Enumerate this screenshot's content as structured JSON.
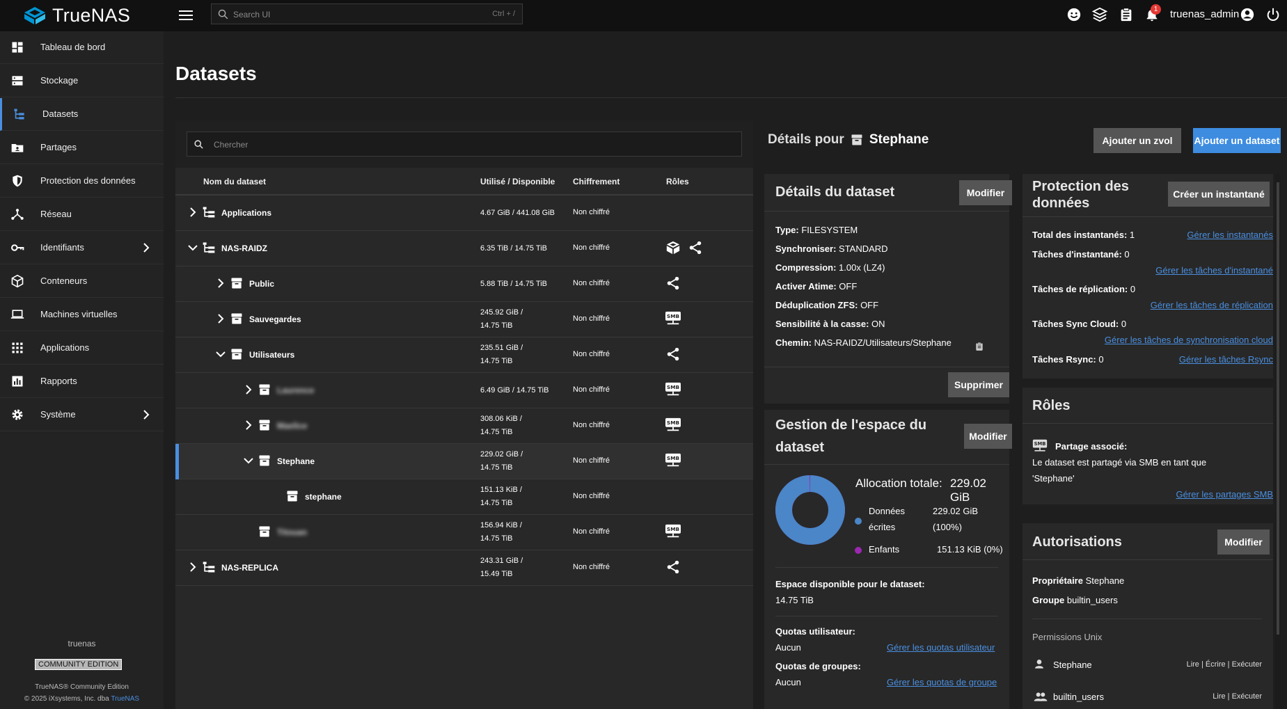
{
  "app": {
    "name": "TrueNAS",
    "search_placeholder": "Search UI",
    "search_shortcut": "Ctrl + /",
    "user": "truenas_admin",
    "alerts_count": "1"
  },
  "sidebar": {
    "items": [
      {
        "label": "Tableau de bord",
        "icon": "dashboard-icon"
      },
      {
        "label": "Stockage",
        "icon": "storage-icon"
      },
      {
        "label": "Datasets",
        "icon": "datasets-icon"
      },
      {
        "label": "Partages",
        "icon": "shares-icon"
      },
      {
        "label": "Protection des données",
        "icon": "shield-icon"
      },
      {
        "label": "Réseau",
        "icon": "network-icon"
      },
      {
        "label": "Identifiants",
        "icon": "key-icon"
      },
      {
        "label": "Conteneurs",
        "icon": "containers-icon"
      },
      {
        "label": "Machines virtuelles",
        "icon": "laptop-icon"
      },
      {
        "label": "Applications",
        "icon": "apps-grid-icon"
      },
      {
        "label": "Rapports",
        "icon": "reports-icon"
      },
      {
        "label": "Système",
        "icon": "gear-icon"
      }
    ],
    "hostname": "truenas",
    "edition": "COMMUNITY EDITION",
    "footer_line1": "TrueNAS® Community Edition",
    "footer_line2_prefix": "© 2025 iXsystems, Inc. dba ",
    "footer_line2_link": "TrueNAS"
  },
  "page": {
    "title": "Datasets"
  },
  "tree": {
    "search_placeholder": "Chercher",
    "columns": [
      "Nom du dataset",
      "Utilisé / Disponible",
      "Chiffrement",
      "Rôles"
    ],
    "rows": [
      {
        "name": "Applications",
        "used1": "4.67 GiB / 441.08 GiB",
        "used2": "",
        "enc": "Non chiffré",
        "roles": []
      },
      {
        "name": "NAS-RAIDZ",
        "used1": "6.35 TiB / 14.75 TiB",
        "used2": "",
        "enc": "Non chiffré",
        "roles": [
          "apps-icon",
          "share-icon"
        ]
      },
      {
        "name": "Public",
        "used1": "5.88 TiB / 14.75 TiB",
        "used2": "",
        "enc": "Non chiffré",
        "roles": [
          "share-icon"
        ]
      },
      {
        "name": "Sauvegardes",
        "used1": "245.92 GiB /",
        "used2": "14.75 TiB",
        "enc": "Non chiffré",
        "roles": [
          "smb-icon"
        ]
      },
      {
        "name": "Utilisateurs",
        "used1": "235.51 GiB /",
        "used2": "14.75 TiB",
        "enc": "Non chiffré",
        "roles": [
          "share-icon"
        ]
      },
      {
        "name": "Laurence",
        "used1": "6.49 GiB / 14.75 TiB",
        "used2": "",
        "enc": "Non chiffré",
        "roles": [
          "smb-icon"
        ]
      },
      {
        "name": "Maelice",
        "used1": "308.06 KiB /",
        "used2": "14.75 TiB",
        "enc": "Non chiffré",
        "roles": [
          "smb-icon"
        ]
      },
      {
        "name": "Stephane",
        "used1": "229.02 GiB /",
        "used2": "14.75 TiB",
        "enc": "Non chiffré",
        "roles": [
          "smb-icon"
        ]
      },
      {
        "name": "stephane",
        "used1": "151.13 KiB /",
        "used2": "14.75 TiB",
        "enc": "Non chiffré",
        "roles": []
      },
      {
        "name": "Titouan",
        "used1": "156.94 KiB /",
        "used2": "14.75 TiB",
        "enc": "Non chiffré",
        "roles": [
          "smb-icon"
        ]
      },
      {
        "name": "NAS-REPLICA",
        "used1": "243.31 GiB /",
        "used2": "15.49 TiB",
        "enc": "Non chiffré",
        "roles": [
          "share-icon"
        ]
      }
    ]
  },
  "details": {
    "header_prefix": "Détails pour",
    "header_name": "Stephane",
    "add_zvol": "Ajouter un zvol",
    "add_dataset": "Ajouter un dataset",
    "dataset_card": {
      "title": "Détails du dataset",
      "edit": "Modifier",
      "delete": "Supprimer",
      "fields": [
        {
          "k": "Type:",
          "v": "FILESYSTEM"
        },
        {
          "k": "Synchroniser:",
          "v": "STANDARD"
        },
        {
          "k": "Compression:",
          "v": "1.00x (LZ4)"
        },
        {
          "k": "Activer Atime:",
          "v": "OFF"
        },
        {
          "k": "Déduplication ZFS:",
          "v": "OFF"
        },
        {
          "k": "Sensibilité à la casse:",
          "v": "ON"
        },
        {
          "k": "Chemin:",
          "v": "NAS-RAIDZ/Utilisateurs/Stephane"
        }
      ]
    },
    "space_card": {
      "title1": "Gestion de l'espace du",
      "title2": "dataset",
      "edit": "Modifier",
      "total_label": "Allocation totale:",
      "total_value": "229.02 GiB",
      "legend": [
        {
          "label1": "Données",
          "label2": "écrites",
          "value1": "229.02 GiB",
          "value2": "(100%)",
          "color": "#4a86c8"
        },
        {
          "label1": "Enfants",
          "label2": "",
          "value1": "151.13 KiB (0%)",
          "value2": "",
          "color": "#9c27b0"
        }
      ],
      "written_fraction": 1.0,
      "avail_label": "Espace disponible pour le dataset:",
      "avail_value": "14.75 TiB",
      "user_quota_label": "Quotas utilisateur:",
      "user_quota_value": "Aucun",
      "user_quota_link": "Gérer les quotas utilisateur",
      "group_quota_label": "Quotas de groupes:",
      "group_quota_value": "Aucun",
      "group_quota_link": "Gérer les quotas de groupe"
    },
    "protection_card": {
      "title1": "Protection des",
      "title2": "données",
      "create_snapshot": "Créer un instantané",
      "snapshots_label": "Total des instantanés:",
      "snapshots_value": "1",
      "snapshots_link": "Gérer les instantanés",
      "snap_tasks_label": "Tâches d'instantané:",
      "snap_tasks_value": "0",
      "snap_tasks_link": "Gérer les tâches d'instantané",
      "repl_label": "Tâches de réplication:",
      "repl_value": "0",
      "repl_link": "Gérer les tâches de réplication",
      "cloud_label": "Tâches Sync Cloud:",
      "cloud_value": "0",
      "cloud_link": "Gérer les tâches de synchronisation cloud",
      "rsync_label": "Tâches Rsync:",
      "rsync_value": "0",
      "rsync_link": "Gérer les tâches Rsync"
    },
    "roles_card": {
      "title": "Rôles",
      "shared_label": "Partage associé:",
      "desc1": "Le dataset est partagé via SMB en tant que",
      "desc2": "'Stephane'",
      "link": "Gérer les partages SMB"
    },
    "auth_card": {
      "title": "Autorisations",
      "edit": "Modifier",
      "owner_label": "Propriétaire",
      "owner_value": "Stephane",
      "group_label": "Groupe",
      "group_value": "builtin_users",
      "unix_title": "Permissions Unix",
      "perms": [
        {
          "who": "Stephane",
          "rights": "Lire | Écrire | Exécuter"
        },
        {
          "who": "builtin_users",
          "rights": "Lire | Exécuter"
        }
      ]
    }
  }
}
